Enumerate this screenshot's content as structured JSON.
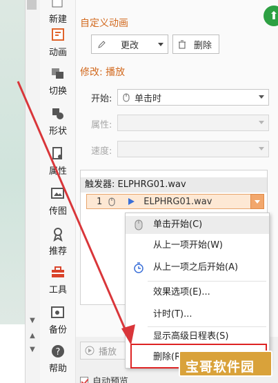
{
  "toolbar": {
    "items": [
      {
        "label": "新建",
        "icon": "new-slide-icon"
      },
      {
        "label": "动画",
        "icon": "animation-icon"
      },
      {
        "label": "切换",
        "icon": "transition-icon"
      },
      {
        "label": "形状",
        "icon": "shape-icon"
      },
      {
        "label": "属性",
        "icon": "properties-icon"
      },
      {
        "label": "传图",
        "icon": "upload-image-icon"
      },
      {
        "label": "推荐",
        "icon": "recommend-icon"
      },
      {
        "label": "工具",
        "icon": "tools-icon"
      },
      {
        "label": "备份",
        "icon": "backup-icon"
      },
      {
        "label": "帮助",
        "icon": "help-icon"
      }
    ]
  },
  "pane": {
    "custom_title": "自定义动画",
    "change_label": "更改",
    "delete_label": "删除",
    "modify_title": "修改: 播放",
    "start_label": "开始:",
    "start_value": "单击时",
    "property_label": "属性:",
    "speed_label": "速度:",
    "trigger_header": "触发器: ELPHRG01.wav",
    "list_item": {
      "index": "1",
      "name": "ELPHRG01.wav"
    },
    "play_label": "播放",
    "autopreview_label": "自动预览"
  },
  "context_menu": {
    "items": [
      {
        "label": "单击开始(C)",
        "icon": "mouse-click-icon"
      },
      {
        "label": "从上一项开始(W)",
        "icon": ""
      },
      {
        "label": "从上一项之后开始(A)",
        "icon": "clock-icon"
      },
      {
        "label": "效果选项(E)..."
      },
      {
        "label": "计时(T)..."
      },
      {
        "label": "显示高级日程表(S)"
      },
      {
        "label": "删除(R)"
      }
    ]
  },
  "watermark": {
    "text": "宝哥软件园"
  },
  "colors": {
    "accent": "#d2691e",
    "highlight": "#d22222",
    "watermark": "#d9a23a"
  }
}
